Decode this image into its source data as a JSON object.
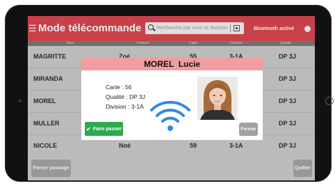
{
  "app": {
    "title": "Mode télécommande",
    "menu_icon": "hamburger-menu-icon"
  },
  "search": {
    "placeholder": "Recherche par nom et division",
    "icon": "search-icon",
    "scan_icon": "qr-code-icon"
  },
  "bluetooth": {
    "label": "Bluetooth activé"
  },
  "table": {
    "headers": [
      "Nom",
      "Prénom",
      "Carte",
      "Division",
      "Qualité"
    ],
    "rows": [
      [
        "MAGRITTE",
        "Zoé",
        "55",
        "3-1A",
        "DP 3J"
      ],
      [
        "MIRANDA",
        "",
        "",
        "",
        "DP 3J"
      ],
      [
        "MOREL",
        "",
        "",
        "",
        "DP 3J"
      ],
      [
        "MULLER",
        "",
        "",
        "",
        "DP 3J"
      ],
      [
        "NICOLE",
        "Noé",
        "59",
        "3-1A",
        "DP 3J"
      ]
    ]
  },
  "footer": {
    "force_label": "Forcer passage",
    "quit_label": "Quitter"
  },
  "modal": {
    "name": "MOREL  Lucie",
    "card": "Carte : 56",
    "quality": "Qualité : DP 3J",
    "division": "Division : 3-1A",
    "pass_label": "Faire passer",
    "close_label": "Fermer",
    "wifi_icon": "wifi-icon",
    "check_icon": "check-icon"
  },
  "colors": {
    "accent": "#d94650",
    "modal_header": "#f29da0",
    "pass_button": "#2eaa4e",
    "wifi_blue": "#2f8ae0"
  }
}
